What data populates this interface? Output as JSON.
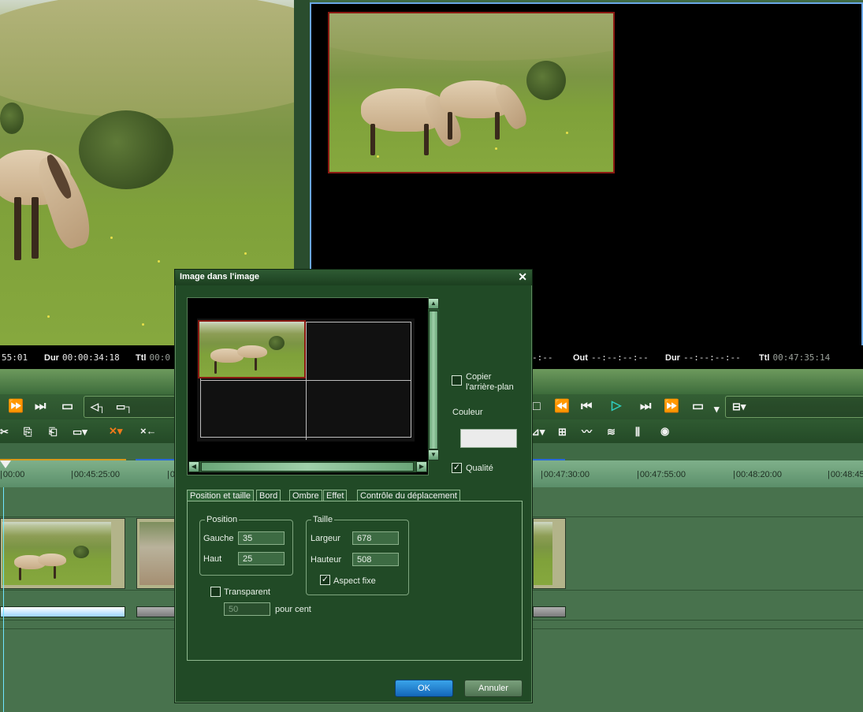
{
  "left_monitor": {
    "timecode_tail": "55:01",
    "dur_label": "Dur",
    "dur_value": "00:00:34:18",
    "ttl_label": "Ttl",
    "ttl_value": "00:0"
  },
  "right_monitor": {
    "in_tail": "-:--",
    "out_label": "Out",
    "out_value": "--:--:--:--",
    "dur_label": "Dur",
    "dur_value": "--:--:--:--",
    "ttl_label": "Ttl",
    "ttl_value": "00:47:35:14"
  },
  "timeline": {
    "ruler_ticks": [
      "00:00",
      "00:45:25:00",
      "0",
      "00:47:30:00",
      "00:47:55:00",
      "00:48:20:00",
      "00:48:45"
    ]
  },
  "dialog": {
    "title": "Image dans l'image",
    "close_glyph": "✕",
    "copy_background_label": "Copier l'arrière-plan",
    "copy_background_line1": "Copier",
    "copy_background_line2": "l'arrière-plan",
    "color_label": "Couleur",
    "color_value": "#ebebeb",
    "quality_label": "Qualité",
    "quality_checked": true,
    "copy_background_checked": false,
    "tabs": [
      "Position et taille",
      "Bord",
      "Ombre",
      "Effet",
      "Contrôle du déplacement"
    ],
    "active_tab": "Position et taille",
    "position": {
      "legend": "Position",
      "left_label": "Gauche",
      "left_value": "35",
      "top_label": "Haut",
      "top_value": "25"
    },
    "size": {
      "legend": "Taille",
      "width_label": "Largeur",
      "width_value": "678",
      "height_label": "Hauteur",
      "height_value": "508",
      "aspect_label": "Aspect fixe",
      "aspect_checked": true
    },
    "transparent_label": "Transparent",
    "transparent_checked": false,
    "percent_value": "50",
    "percent_label": "pour cent",
    "ok_label": "OK",
    "cancel_label": "Annuler"
  },
  "colors": {
    "accent_blue": "#1f80d4",
    "dialog_bg": "#214a26",
    "pip_border": "#8b1a12"
  }
}
